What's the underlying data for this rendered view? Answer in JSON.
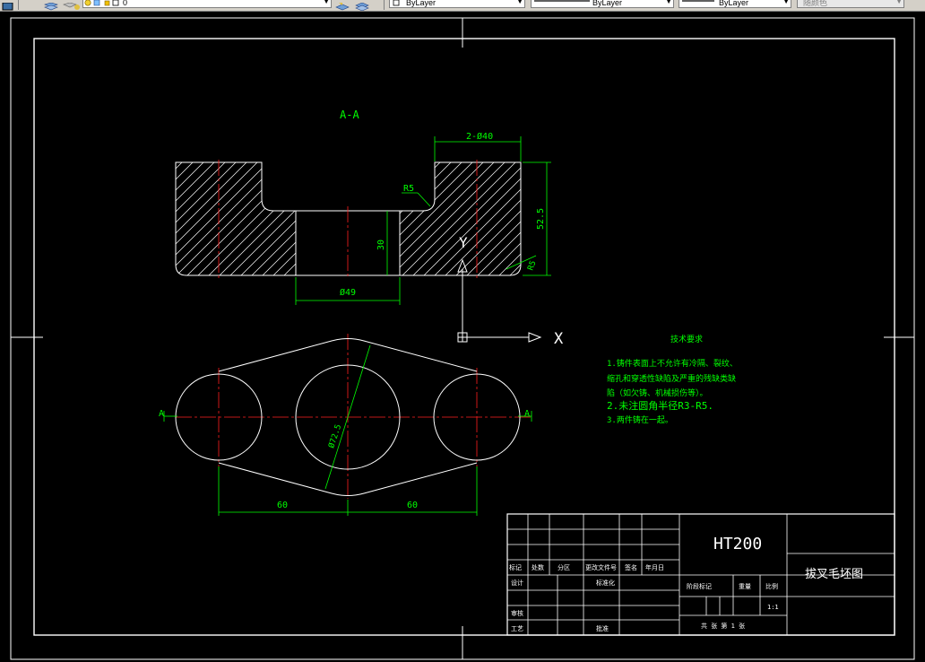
{
  "toolbar": {
    "layer_value": "0",
    "color_value": "ByLayer",
    "linetype_value": "ByLayer",
    "lineweight_value": "ByLayer",
    "plotstyle_value": "随颜色"
  },
  "drawing": {
    "section_label": "A-A",
    "dim_2x40": "2-Ø40",
    "dim_r5_top": "R5",
    "dim_52_5": "52.5",
    "dim_30": "30",
    "dim_r5_side": "R5",
    "dim_49": "Ø49",
    "dim_72_5": "Ø72.5",
    "dim_60_left": "60",
    "dim_60_right": "60",
    "section_mark_left": "A",
    "section_mark_right": "A",
    "ucs_x": "X",
    "ucs_y": "Y"
  },
  "notes": {
    "title": "技术要求",
    "line1": "1.铸件表面上不允许有冷隔、裂纹、",
    "line2": "缩孔和穿透性缺陷及严重的残缺类缺",
    "line3": "陷（如欠铸、机械损伤等）。",
    "line4": "2.未注圆角半径R3-R5.",
    "line5": "3.两件铸在一起。"
  },
  "title_block": {
    "material": "HT200",
    "part_name": "拔叉毛坯图",
    "h_mark": "标记",
    "h_count": "处数",
    "h_zone": "分区",
    "h_doc": "更改文件号",
    "h_sign": "签名",
    "h_date": "年月日",
    "h_design": "设计",
    "h_std": "标准化",
    "h_review": "审核",
    "h_craft": "工艺",
    "h_approve": "批准",
    "h_stage": "阶段标记",
    "h_weight": "重量",
    "h_scale": "比例",
    "scale_value": "1:1",
    "sheets": "共   张  第  1 张"
  }
}
